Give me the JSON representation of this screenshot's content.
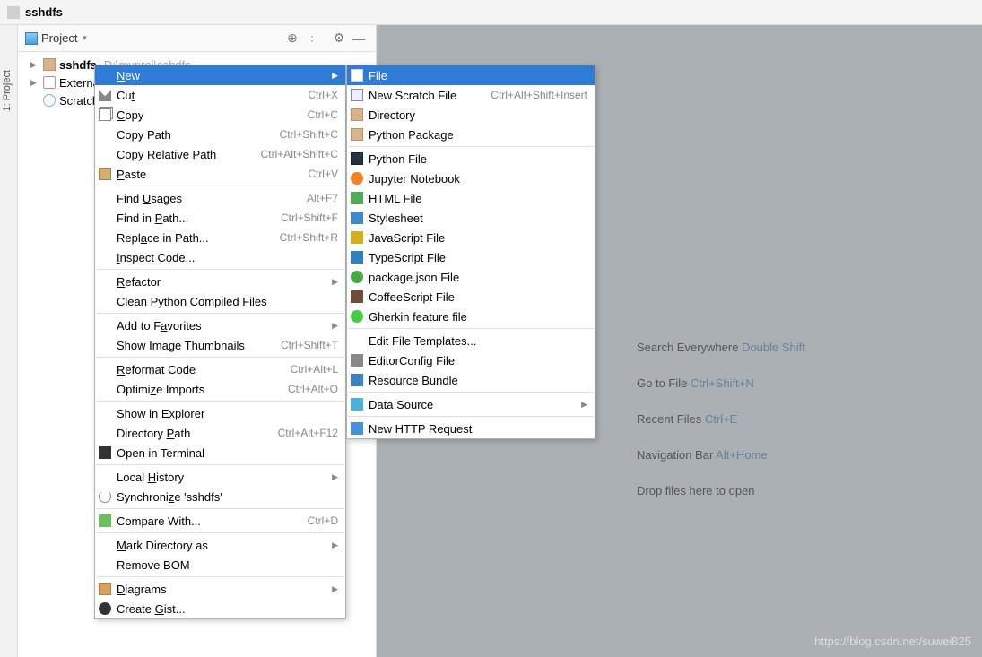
{
  "title": "sshdfs",
  "gutter_label": "1: Project",
  "toolbar": {
    "label": "Project"
  },
  "tree": {
    "root": {
      "name": "sshdfs",
      "path": "D:\\myproj\\sshdfs"
    },
    "ext": "External",
    "scratch": "Scratches"
  },
  "hints": [
    {
      "t": "Search Everywhere ",
      "s": "Double Shift"
    },
    {
      "t": "Go to File ",
      "s": "Ctrl+Shift+N"
    },
    {
      "t": "Recent Files ",
      "s": "Ctrl+E"
    },
    {
      "t": "Navigation Bar ",
      "s": "Alt+Home"
    },
    {
      "t": "Drop files here to open",
      "s": ""
    }
  ],
  "watermark": "https://blog.csdn.net/suwei825",
  "ctx": [
    {
      "type": "item",
      "sel": true,
      "label": "<u>N</u>ew",
      "arrow": true
    },
    {
      "type": "item",
      "icon": "ic-cut",
      "label": "Cu<u>t</u>",
      "sc": "Ctrl+X"
    },
    {
      "type": "item",
      "icon": "ic-copy",
      "label": "<u>C</u>opy",
      "sc": "Ctrl+C"
    },
    {
      "type": "item",
      "label": "Copy Path",
      "sc": "Ctrl+Shift+C"
    },
    {
      "type": "item",
      "label": "Copy Relative Path",
      "sc": "Ctrl+Alt+Shift+C"
    },
    {
      "type": "item",
      "icon": "ic-paste",
      "label": "<u>P</u>aste",
      "sc": "Ctrl+V"
    },
    {
      "type": "sep"
    },
    {
      "type": "item",
      "label": "Find <u>U</u>sages",
      "sc": "Alt+F7"
    },
    {
      "type": "item",
      "label": "Find in <u>P</u>ath...",
      "sc": "Ctrl+Shift+F"
    },
    {
      "type": "item",
      "label": "Repl<u>a</u>ce in Path...",
      "sc": "Ctrl+Shift+R"
    },
    {
      "type": "item",
      "label": "<u>I</u>nspect Code..."
    },
    {
      "type": "sep"
    },
    {
      "type": "item",
      "label": "<u>R</u>efactor",
      "arrow": true
    },
    {
      "type": "item",
      "label": "Clean P<u>y</u>thon Compiled Files"
    },
    {
      "type": "sep"
    },
    {
      "type": "item",
      "label": "Add to F<u>a</u>vorites",
      "arrow": true
    },
    {
      "type": "item",
      "label": "Show Ima<u>g</u>e Thumbnails",
      "sc": "Ctrl+Shift+T"
    },
    {
      "type": "sep"
    },
    {
      "type": "item",
      "label": "<u>R</u>eformat Code",
      "sc": "Ctrl+Alt+L"
    },
    {
      "type": "item",
      "label": "Optimi<u>z</u>e Imports",
      "sc": "Ctrl+Alt+O"
    },
    {
      "type": "sep"
    },
    {
      "type": "item",
      "label": "Sho<u>w</u> in Explorer"
    },
    {
      "type": "item",
      "label": "Directory <u>P</u>ath",
      "sc": "Ctrl+Alt+F12"
    },
    {
      "type": "item",
      "icon": "ic-term",
      "label": "Open in Terminal"
    },
    {
      "type": "sep"
    },
    {
      "type": "item",
      "label": "Local <u>H</u>istory",
      "arrow": true
    },
    {
      "type": "item",
      "icon": "ic-sync",
      "label": "Synchroni<u>z</u>e 'sshdfs'"
    },
    {
      "type": "sep"
    },
    {
      "type": "item",
      "icon": "ic-cmp",
      "label": "Compare With...",
      "sc": "Ctrl+D"
    },
    {
      "type": "sep"
    },
    {
      "type": "item",
      "label": "<u>M</u>ark Directory as",
      "arrow": true
    },
    {
      "type": "item",
      "label": "Remove BOM"
    },
    {
      "type": "sep"
    },
    {
      "type": "item",
      "icon": "ic-diag",
      "label": "<u>D</u>iagrams",
      "arrow": true
    },
    {
      "type": "item",
      "icon": "ic-gh",
      "label": "Create <u>G</u>ist..."
    }
  ],
  "sub": [
    {
      "type": "item",
      "sel": true,
      "icon": "ic-file",
      "label": "File"
    },
    {
      "type": "item",
      "icon": "ic-sfile",
      "label": "New Scratch File",
      "sc": "Ctrl+Alt+Shift+Insert"
    },
    {
      "type": "item",
      "icon": "ic-dir",
      "label": "Directory"
    },
    {
      "type": "item",
      "icon": "ic-dir",
      "label": "Python Package"
    },
    {
      "type": "sep"
    },
    {
      "type": "item",
      "icon": "ic-py",
      "label": "Python File"
    },
    {
      "type": "item",
      "icon": "ic-jup",
      "label": "Jupyter Notebook"
    },
    {
      "type": "item",
      "icon": "ic-html",
      "label": "HTML File"
    },
    {
      "type": "item",
      "icon": "ic-css",
      "label": "Stylesheet"
    },
    {
      "type": "item",
      "icon": "ic-js",
      "label": "JavaScript File"
    },
    {
      "type": "item",
      "icon": "ic-ts",
      "label": "TypeScript File"
    },
    {
      "type": "item",
      "icon": "ic-json",
      "label": "package.json File"
    },
    {
      "type": "item",
      "icon": "ic-coffee",
      "label": "CoffeeScript File"
    },
    {
      "type": "item",
      "icon": "ic-ghk",
      "label": "Gherkin feature file"
    },
    {
      "type": "sep"
    },
    {
      "type": "item",
      "label": "Edit File Templates..."
    },
    {
      "type": "item",
      "icon": "ic-ec",
      "label": "EditorConfig File"
    },
    {
      "type": "item",
      "icon": "ic-rb",
      "label": "Resource Bundle"
    },
    {
      "type": "sep"
    },
    {
      "type": "item",
      "icon": "ic-ds",
      "label": "Data Source",
      "arrow": true
    },
    {
      "type": "sep"
    },
    {
      "type": "item",
      "icon": "ic-http",
      "label": "New HTTP Request"
    }
  ]
}
